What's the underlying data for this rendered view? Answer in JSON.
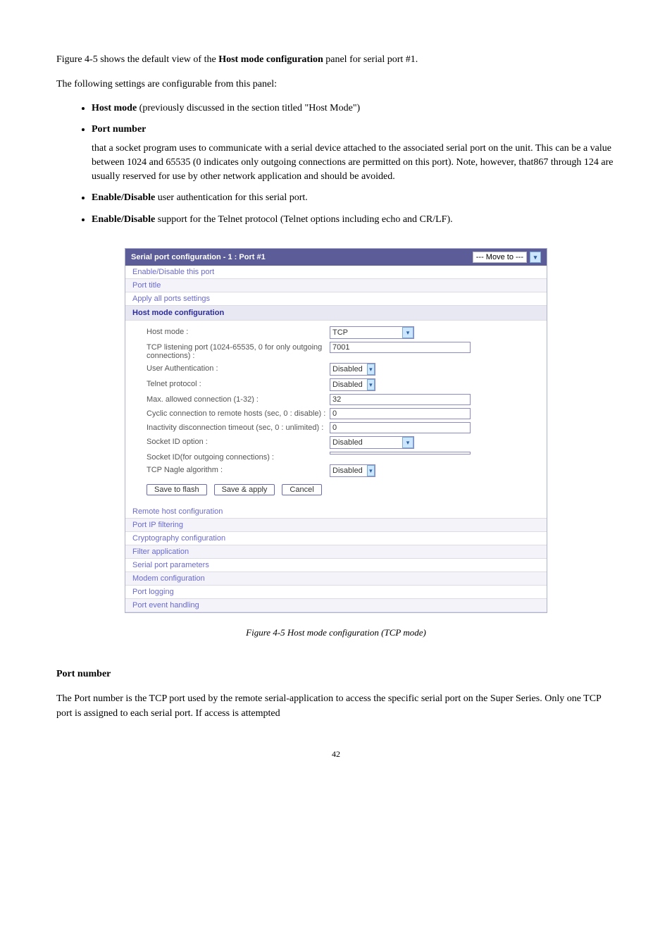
{
  "doc": {
    "section_num_title": "Figure 4-5 shows the default view of the",
    "section_hl": "Host mode configuration",
    "section_tail": "panel for serial port #1.",
    "features_heading": "The following settings are configurable from this panel:",
    "features": [
      {
        "head": "Host mode",
        "desc": "(previously discussed in the section titled \"Host Mode\")"
      },
      {
        "head": "Port number",
        "desc": "that a socket program uses to communicate with a serial device attached to the associated serial port on the unit.  This can be a value between 1024 and 65535 (0 indicates only outgoing connections are permitted on this port). Note, however, that867 through 124 are usually reserved for use by other network application and should be avoided."
      },
      {
        "head": "Enable/Disable",
        "desc_pre": "",
        "desc": " user authentication for this serial port."
      },
      {
        "head": "Enable/Disable",
        "desc": " support for the Telnet protocol (Telnet options including echo and CR/LF)."
      }
    ],
    "screenshot": {
      "title": "Serial port configuration - 1 : Port #1",
      "move_to": "--- Move to ---",
      "rows_top": [
        "Enable/Disable this port",
        "Port title",
        "Apply all ports settings"
      ],
      "section_head": "Host mode configuration",
      "config": [
        {
          "label": "Host mode :",
          "type": "select-small",
          "value": "TCP"
        },
        {
          "label": "TCP listening port (1024-65535, 0 for only outgoing connections) :",
          "type": "text",
          "value": "7001"
        },
        {
          "label": "User Authentication :",
          "type": "select-tiny",
          "value": "Disabled"
        },
        {
          "label": "Telnet protocol :",
          "type": "select-tiny",
          "value": "Disabled"
        },
        {
          "label": "Max. allowed connection (1-32) :",
          "type": "text",
          "value": "32"
        },
        {
          "label": "Cyclic connection to remote hosts (sec, 0 : disable) :",
          "type": "text",
          "value": "0"
        },
        {
          "label": "Inactivity disconnection timeout (sec, 0 : unlimited) :",
          "type": "text",
          "value": "0"
        },
        {
          "label": "Socket ID option :",
          "type": "select-small",
          "value": "Disabled"
        },
        {
          "label": "Socket ID(for outgoing connections) :",
          "type": "text",
          "value": ""
        },
        {
          "label": "TCP Nagle algorithm :",
          "type": "select-tiny",
          "value": "Disabled"
        }
      ],
      "buttons": [
        "Save to flash",
        "Save & apply",
        "Cancel"
      ],
      "rows_bottom": [
        "Remote host configuration",
        "Port IP filtering",
        "Cryptography configuration",
        "Filter application",
        "Serial port parameters",
        "Modem configuration",
        "Port logging",
        "Port event handling"
      ]
    },
    "figure_caption": "Figure 4-5 Host mode configuration (TCP mode)",
    "post_heading": "Port number",
    "post_para": "The Port number is the TCP port used by the remote serial-application to access the specific serial port on the Super Series. Only one TCP port is assigned to each serial port. If access is attempted",
    "page_number": "42"
  }
}
